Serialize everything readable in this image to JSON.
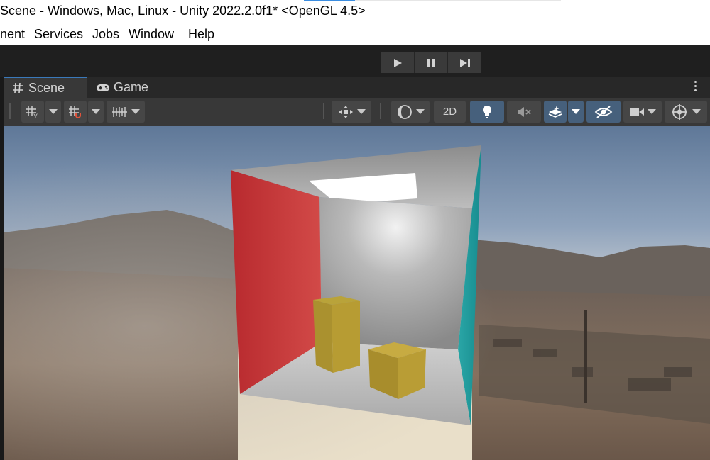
{
  "window": {
    "title": "Scene - Windows, Mac, Linux - Unity 2022.2.0f1* <OpenGL 4.5>"
  },
  "menu": {
    "items": [
      {
        "label": "nent"
      },
      {
        "label": "Services"
      },
      {
        "label": "Jobs"
      },
      {
        "label": "Window"
      },
      {
        "label": "Help"
      }
    ]
  },
  "play_controls": {
    "play": "play-icon",
    "pause": "pause-icon",
    "step": "step-icon"
  },
  "tabs": [
    {
      "label": "Scene",
      "icon": "hash-icon",
      "active": true
    },
    {
      "label": "Game",
      "icon": "gamepad-icon",
      "active": false
    }
  ],
  "scene_toolbar": {
    "mode_2d_label": "2D",
    "lighting_on": true,
    "effects_on": true,
    "visibility_on": true
  },
  "colors": {
    "accent": "#3a79bb",
    "toggle_on": "#46607c",
    "panel": "#383838"
  }
}
